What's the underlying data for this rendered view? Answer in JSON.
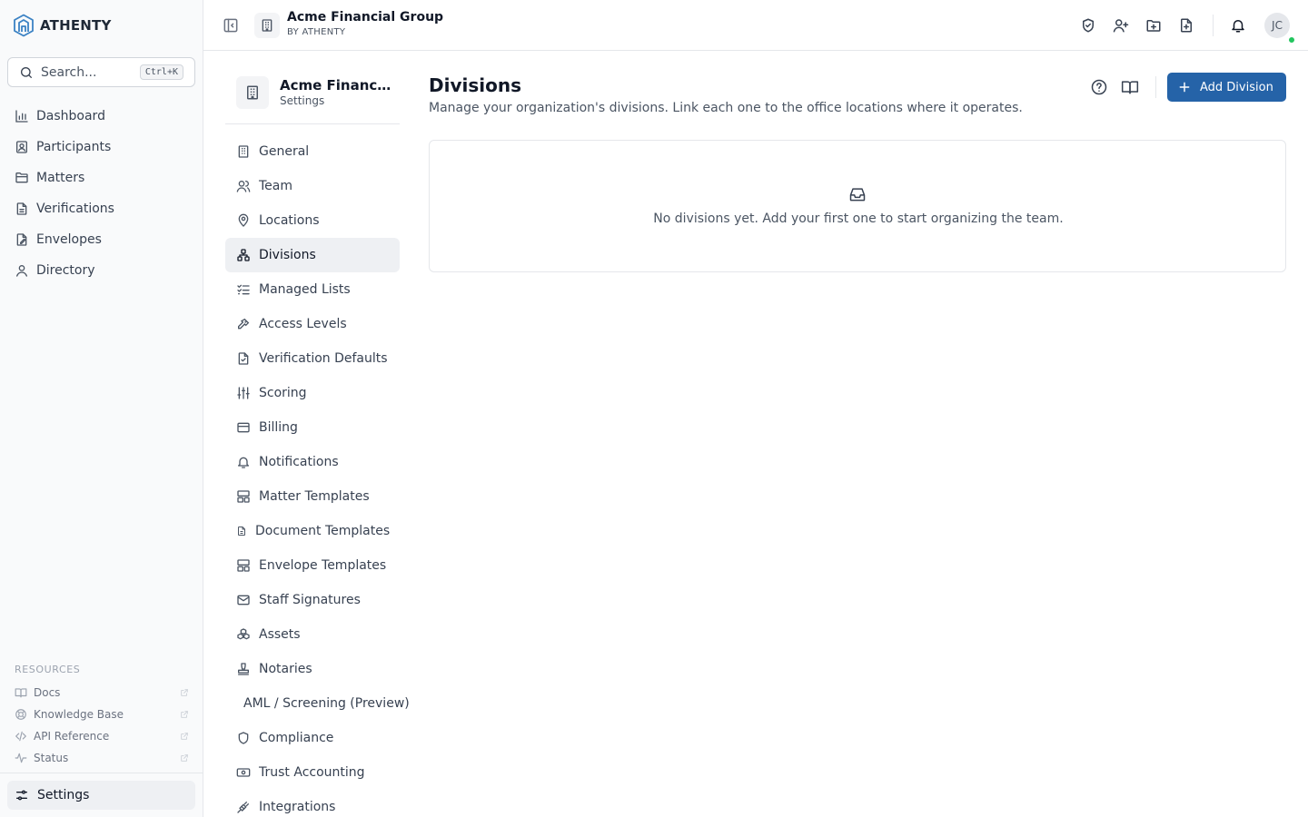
{
  "brand": {
    "name": "ATHENTY"
  },
  "search": {
    "placeholder": "Search...",
    "shortcut": "Ctrl+K"
  },
  "sidebar": {
    "items": [
      {
        "label": "Dashboard",
        "icon": "bar-chart-icon"
      },
      {
        "label": "Participants",
        "icon": "contact-icon"
      },
      {
        "label": "Matters",
        "icon": "folder-icon"
      },
      {
        "label": "Verifications",
        "icon": "document-icon"
      },
      {
        "label": "Envelopes",
        "icon": "signature-icon"
      },
      {
        "label": "Directory",
        "icon": "user-icon"
      }
    ],
    "resources_title": "RESOURCES",
    "resources": [
      {
        "label": "Docs",
        "icon": "book-icon"
      },
      {
        "label": "Knowledge Base",
        "icon": "lifebuoy-icon"
      },
      {
        "label": "API Reference",
        "icon": "code-icon"
      },
      {
        "label": "Status",
        "icon": "activity-icon"
      }
    ],
    "settings_label": "Settings"
  },
  "topbar": {
    "org_name": "Acme Financial Group",
    "org_sub": "BY ATHENTY",
    "avatar_initials": "JC"
  },
  "settings_nav": {
    "org_name": "Acme Financial Group",
    "subtitle": "Settings",
    "items": [
      {
        "label": "General",
        "icon": "building-icon"
      },
      {
        "label": "Team",
        "icon": "users-icon"
      },
      {
        "label": "Locations",
        "icon": "map-pin-icon"
      },
      {
        "label": "Divisions",
        "icon": "network-icon",
        "active": true
      },
      {
        "label": "Managed Lists",
        "icon": "list-check-icon"
      },
      {
        "label": "Access Levels",
        "icon": "key-icon"
      },
      {
        "label": "Verification Defaults",
        "icon": "file-check-icon"
      },
      {
        "label": "Scoring",
        "icon": "sliders-icon"
      },
      {
        "label": "Billing",
        "icon": "credit-card-icon"
      },
      {
        "label": "Notifications",
        "icon": "bell-icon"
      },
      {
        "label": "Matter Templates",
        "icon": "layout-icon"
      },
      {
        "label": "Document Templates",
        "icon": "file-icon"
      },
      {
        "label": "Envelope Templates",
        "icon": "layout-icon"
      },
      {
        "label": "Staff Signatures",
        "icon": "mail-icon"
      },
      {
        "label": "Assets",
        "icon": "boxes-icon"
      },
      {
        "label": "Notaries",
        "icon": "stamp-icon"
      },
      {
        "label": "AML / Screening (Preview)",
        "icon": ""
      },
      {
        "label": "Compliance",
        "icon": "shield-icon"
      },
      {
        "label": "Trust Accounting",
        "icon": "banknote-icon"
      },
      {
        "label": "Integrations",
        "icon": "plug-icon"
      }
    ]
  },
  "main": {
    "title": "Divisions",
    "description": "Manage your organization's divisions. Link each one to the office locations where it operates.",
    "add_button_label": "Add Division",
    "empty_text": "No divisions yet. Add your first one to start organizing the team."
  },
  "colors": {
    "accent": "#2563a8",
    "online": "#22c55e",
    "active_bg": "#eef0f3"
  }
}
